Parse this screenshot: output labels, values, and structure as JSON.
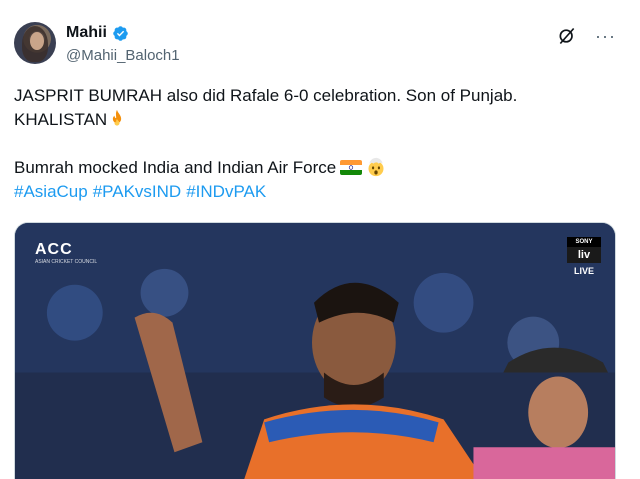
{
  "tweet": {
    "display_name": "Mahii",
    "handle": "@Mahii_Baloch1",
    "lines": [
      "JASPRIT BUMRAH also did Rafale 6-0 celebration. Son of Punjab.",
      "KHALISTAN",
      "Bumrah mocked India and Indian Air Force"
    ],
    "hashtags": [
      "#AsiaCup",
      "#PAKvsIND",
      "#INDvPAK"
    ],
    "icons": {
      "verified": "verified-badge-icon",
      "grok": "grok-icon",
      "more": "more-options-icon",
      "fire": "fire-emoji",
      "india_flag": "india-flag-emoji",
      "shocked": "exploding-head-emoji"
    },
    "more_glyph": "···"
  },
  "media": {
    "broadcaster_logo": "ACC",
    "broadcaster_sub": "ASIAN CRICKET COUNCIL",
    "channel_top": "SONY",
    "channel_mid": "liv",
    "live_label": "LIVE"
  },
  "colors": {
    "link": "#1d9bf0",
    "verified": "#1d9bf0",
    "secondary_text": "#536471"
  }
}
